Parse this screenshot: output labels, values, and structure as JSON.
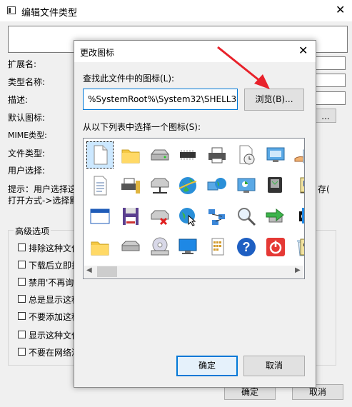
{
  "background_window": {
    "title": "编辑文件类型",
    "close_glyph": "✕",
    "labels": {
      "extension": "扩展名:",
      "type_name": "类型名称:",
      "description": "描述:",
      "default_icon": "默认图标:",
      "mime_type": "MIME类型:",
      "file_type": "文件类型:",
      "user_choice": "用户选择:"
    },
    "tip_line1": "提示：用户选择这",
    "tip_line1_tail": "存(",
    "tip_line2": "打开方式->选择默",
    "advanced_title": "高级选项",
    "checkboxes": [
      "排除这种文件",
      "下载后立即打",
      "禁用'不再询",
      "总是显示这种",
      "不要添加这种",
      "显示这种文件",
      "不要在网络浏"
    ],
    "default_icon_button": "...",
    "ok_label": "确定",
    "cancel_label": "取消"
  },
  "dialog": {
    "title": "更改图标",
    "close_glyph": "✕",
    "find_label": "查找此文件中的图标(L):",
    "path_value": "%SystemRoot%\\System32\\SHELL32.",
    "browse_label": "浏览(B)...",
    "select_label": "从以下列表中选择一个图标(S):",
    "icons": [
      "blank-document-icon",
      "folder-icon",
      "hard-drive-icon",
      "memory-chip-icon",
      "printer-icon",
      "document-clock-icon",
      "monitor-window-icon",
      "sharing-hand-icon",
      "recycle-bin-partial-icon",
      "text-document-icon",
      "network-printer-icon",
      "network-drive-icon",
      "globe-icon",
      "network-globe-icon",
      "control-panel-icon",
      "disk-shortcut-icon",
      "shortcut-arrow-icon",
      "scroll-partial-icon",
      "window-icon",
      "floppy-disk-icon",
      "disconnected-drive-icon",
      "globe-cursor-icon",
      "network-nodes-icon",
      "magnifier-icon",
      "usb-arrow-icon",
      "black-badge-icon",
      "blue-square-partial-icon",
      "folder-icon",
      "drive-icon",
      "cd-drive-icon",
      "computer-icon",
      "document-grid-icon",
      "help-icon",
      "power-icon",
      "recycle-bin-icon",
      "tools-partial-icon"
    ],
    "scroll_left": "◀",
    "scroll_right": "▶",
    "ok_label": "确定",
    "cancel_label": "取消"
  },
  "colors": {
    "accent": "#0078d7",
    "arrow": "#e8212a"
  }
}
